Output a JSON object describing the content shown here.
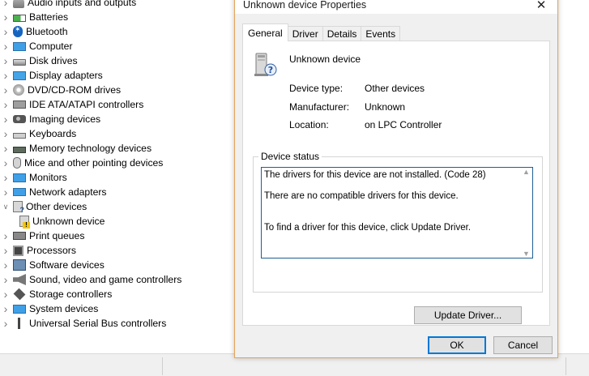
{
  "tree": {
    "items": [
      {
        "label": "Audio inputs and outputs",
        "icon": "speaker-icon",
        "kind": "i-audio",
        "expanded": false,
        "child": false
      },
      {
        "label": "Batteries",
        "icon": "battery-icon",
        "kind": "i-battery",
        "expanded": false,
        "child": false
      },
      {
        "label": "Bluetooth",
        "icon": "bluetooth-icon",
        "kind": "i-bt",
        "expanded": false,
        "child": false
      },
      {
        "label": "Computer",
        "icon": "computer-icon",
        "kind": "i-computer",
        "expanded": false,
        "child": false
      },
      {
        "label": "Disk drives",
        "icon": "disk-drive-icon",
        "kind": "i-disk",
        "expanded": false,
        "child": false
      },
      {
        "label": "Display adapters",
        "icon": "display-adapter-icon",
        "kind": "i-display",
        "expanded": false,
        "child": false
      },
      {
        "label": "DVD/CD-ROM drives",
        "icon": "dvd-icon",
        "kind": "i-dvd",
        "expanded": false,
        "child": false
      },
      {
        "label": "IDE ATA/ATAPI controllers",
        "icon": "ide-controller-icon",
        "kind": "i-ide",
        "expanded": false,
        "child": false
      },
      {
        "label": "Imaging devices",
        "icon": "camera-icon",
        "kind": "i-camera",
        "expanded": false,
        "child": false
      },
      {
        "label": "Keyboards",
        "icon": "keyboard-icon",
        "kind": "i-keyboard",
        "expanded": false,
        "child": false
      },
      {
        "label": "Memory technology devices",
        "icon": "memory-icon",
        "kind": "i-memory",
        "expanded": false,
        "child": false
      },
      {
        "label": "Mice and other pointing devices",
        "icon": "mouse-icon",
        "kind": "i-mouse",
        "expanded": false,
        "child": false
      },
      {
        "label": "Monitors",
        "icon": "monitor-icon",
        "kind": "i-monitor",
        "expanded": false,
        "child": false
      },
      {
        "label": "Network adapters",
        "icon": "network-adapter-icon",
        "kind": "i-network",
        "expanded": false,
        "child": false
      },
      {
        "label": "Other devices",
        "icon": "unknown-device-group-icon",
        "kind": "i-other",
        "expanded": true,
        "child": false
      },
      {
        "label": "Unknown device",
        "icon": "warning-device-icon",
        "kind": "i-unknown",
        "expanded": false,
        "child": true
      },
      {
        "label": "Print queues",
        "icon": "printer-icon",
        "kind": "i-print",
        "expanded": false,
        "child": false
      },
      {
        "label": "Processors",
        "icon": "processor-icon",
        "kind": "i-cpu",
        "expanded": false,
        "child": false
      },
      {
        "label": "Software devices",
        "icon": "software-device-icon",
        "kind": "i-software",
        "expanded": false,
        "child": false
      },
      {
        "label": "Sound, video and game controllers",
        "icon": "sound-icon",
        "kind": "i-sound",
        "expanded": false,
        "child": false
      },
      {
        "label": "Storage controllers",
        "icon": "storage-controller-icon",
        "kind": "i-storage",
        "expanded": false,
        "child": false
      },
      {
        "label": "System devices",
        "icon": "system-device-icon",
        "kind": "i-system",
        "expanded": false,
        "child": false
      },
      {
        "label": "Universal Serial Bus controllers",
        "icon": "usb-icon",
        "kind": "i-usb",
        "expanded": false,
        "child": false
      }
    ]
  },
  "dialog": {
    "title": "Unknown device Properties",
    "close_glyph": "✕",
    "tabs": [
      {
        "label": "General",
        "active": true
      },
      {
        "label": "Driver",
        "active": false
      },
      {
        "label": "Details",
        "active": false
      },
      {
        "label": "Events",
        "active": false
      }
    ],
    "device_name": "Unknown device",
    "properties": [
      {
        "key": "Device type:",
        "value": "Other devices"
      },
      {
        "key": "Manufacturer:",
        "value": "Unknown"
      },
      {
        "key": "Location:",
        "value": "on LPC Controller"
      }
    ],
    "status_group_label": "Device status",
    "status_lines": [
      "The drivers for this device are not installed. (Code 28)",
      "There are no compatible drivers for this device.",
      "To find a driver for this device, click Update Driver."
    ],
    "update_driver_label": "Update Driver...",
    "ok_label": "OK",
    "cancel_label": "Cancel"
  },
  "colors": {
    "dialog_border": "#e6a35a",
    "focus_blue": "#0078d7",
    "status_border": "#1f5e93"
  }
}
